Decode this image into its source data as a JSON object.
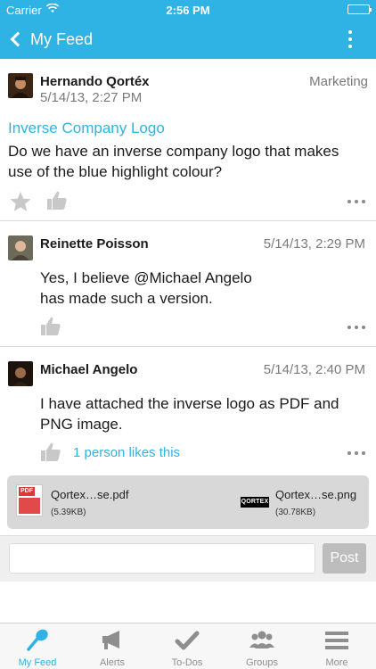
{
  "status_bar": {
    "carrier": "Carrier",
    "time": "2:56 PM"
  },
  "nav": {
    "back_label": "My Feed"
  },
  "posts": [
    {
      "author": "Hernando Qortéx",
      "timestamp": "5/14/13, 2:27 PM",
      "group": "Marketing",
      "subject": "Inverse Company Logo",
      "body": "Do we have an inverse company logo that makes use of the blue highlight colour?"
    },
    {
      "author": "Reinette Poisson",
      "timestamp": "5/14/13, 2:29 PM",
      "body_lines": [
        "Yes, I believe @Michael Angelo",
        "has made such a version."
      ]
    },
    {
      "author": "Michael Angelo",
      "timestamp": "5/14/13, 2:40 PM",
      "body_lines": [
        "I have attached the inverse logo as PDF and",
        "PNG image."
      ],
      "likes": "1 person likes this"
    }
  ],
  "attachments": [
    {
      "name": "Qortex…se.pdf",
      "size": "(5.39KB)",
      "icon": "pdf-file-icon",
      "badge": "PDF"
    },
    {
      "name": "Qortex…se.png",
      "size": "(30.78KB)",
      "icon": "image-file-icon",
      "logo": "QORTEX"
    }
  ],
  "reply": {
    "placeholder": "",
    "button": "Post"
  },
  "tabs": [
    {
      "label": "My Feed",
      "icon": "feed-icon",
      "active": true
    },
    {
      "label": "Alerts",
      "icon": "megaphone-icon",
      "active": false
    },
    {
      "label": "To-Dos",
      "icon": "checkmark-icon",
      "active": false
    },
    {
      "label": "Groups",
      "icon": "groups-icon",
      "active": false
    },
    {
      "label": "More",
      "icon": "menu-icon",
      "active": false
    }
  ],
  "colors": {
    "accent": "#2fb2e4",
    "icon_gray": "#8e8e8e"
  }
}
